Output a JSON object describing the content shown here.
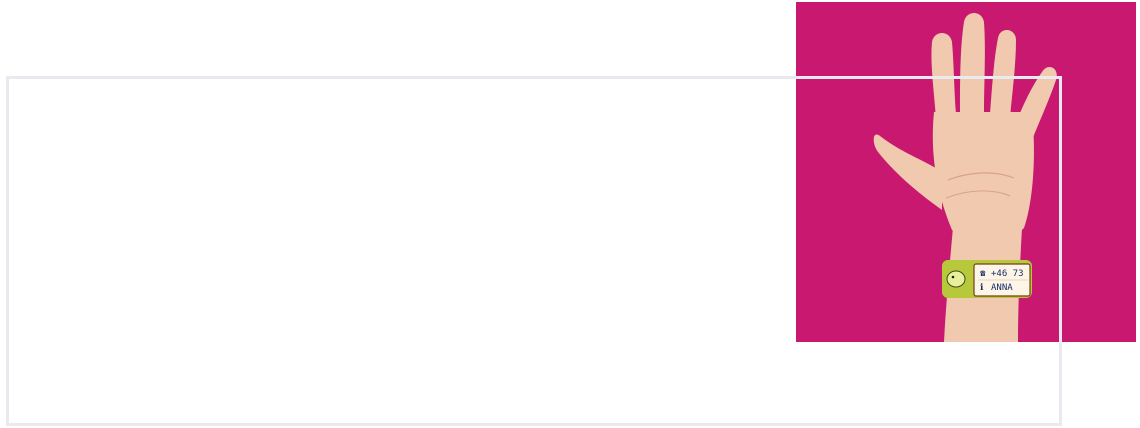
{
  "colors": {
    "panel_background": "#c8186f",
    "frame_border": "#e9eaf0",
    "skin": "#f1c9ae",
    "wristband": "#b7c93a",
    "band_label": "#fdf6e6",
    "band_text": "#1b2a6b"
  },
  "wristband": {
    "phone_icon": "☎",
    "phone_text": "+46 73",
    "info_icon": "ℹ",
    "name_text": "ANNA"
  }
}
